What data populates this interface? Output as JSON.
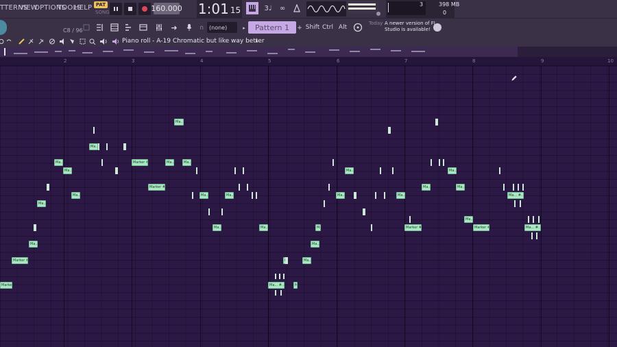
{
  "menu": {
    "patterns": "TTERNS",
    "view": "VIEW",
    "options": "OPTIONS",
    "tools": "TOOLS",
    "help": "HELP"
  },
  "transport": {
    "pat_label": "PAT",
    "song_label": "SONG",
    "tempo": "160.000",
    "time": "1:01",
    "time_ticks": "15"
  },
  "status": {
    "voices": "3",
    "ram": "398 MB",
    "polyphony": "0"
  },
  "toolbar2": {
    "cpu_label": "C8 / 96",
    "channel_select": "(none)",
    "pattern": "Pattern 1",
    "keys": [
      "Shift",
      "Ctrl",
      "Alt"
    ]
  },
  "news": {
    "today": "Today",
    "text": "A newer version of FL Studio is available!"
  },
  "piano_roll": {
    "title": "Piano roll - A-19 Chromatic but like way better"
  },
  "ruler": {
    "bars": [
      "2",
      "3",
      "4",
      "5",
      "6",
      "7",
      "8",
      "9",
      "10"
    ]
  },
  "notes": [
    {
      "label": "Ma..."
    },
    {
      "label": "Ma..."
    },
    {
      "label": "Ma..."
    },
    {
      "label": "Marker #..."
    },
    {
      "label": "Ma..."
    },
    {
      "label": "Ma..."
    },
    {
      "label": "Ma..."
    },
    {
      "label": "Ma..."
    },
    {
      "label": "Marker #..."
    },
    {
      "label": "Ma..."
    },
    {
      "label": "Ma..."
    },
    {
      "label": "Ma..."
    },
    {
      "label": "Ma..."
    },
    {
      "label": "Ma..."
    },
    {
      "label": "Ma..."
    },
    {
      "label": "Ma..."
    },
    {
      "label": "Ma..."
    },
    {
      "label": "Marker #..."
    },
    {
      "label": "Marker #..."
    },
    {
      "label": "Ma..."
    },
    {
      "label": "Ma..."
    },
    {
      "label": "Ma..."
    },
    {
      "label": "Ma..."
    },
    {
      "label": "Ma..."
    },
    {
      "label": "Ma..."
    },
    {
      "label": "Ma..."
    },
    {
      "label": "Ma..."
    },
    {
      "label": "Marker #..."
    },
    {
      "label": "Ma..."
    },
    {
      "label": "Marker #..."
    },
    {
      "label": "Ma... #..."
    },
    {
      "label": "Ma... #..."
    },
    {
      "label": "Ma... #..."
    },
    {
      "label": "Marker #..."
    }
  ]
}
